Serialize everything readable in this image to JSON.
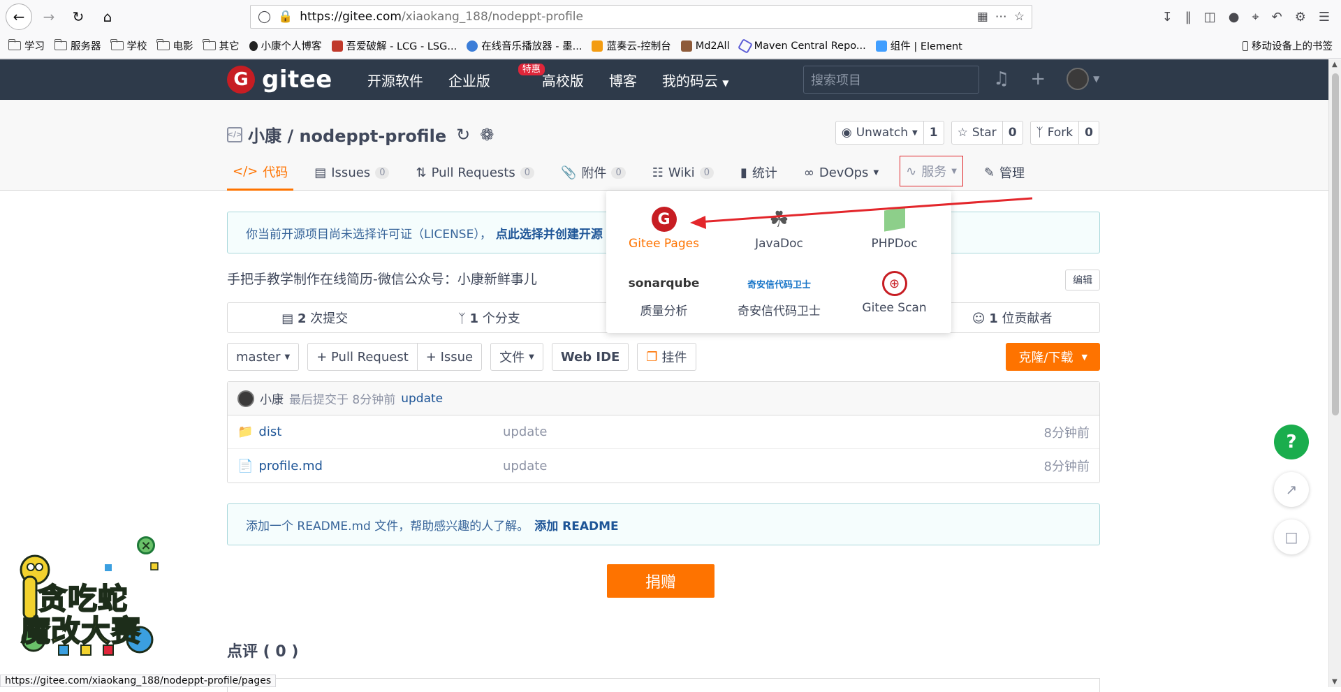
{
  "browser": {
    "url_host": "https://gitee.com",
    "url_path": "/xiaokang_188/nodeppt-profile",
    "status_url": "https://gitee.com/xiaokang_188/nodeppt-profile/pages"
  },
  "bookmarks": [
    {
      "label": "学习",
      "type": "folder"
    },
    {
      "label": "服务器",
      "type": "folder"
    },
    {
      "label": "学校",
      "type": "folder"
    },
    {
      "label": "电影",
      "type": "folder"
    },
    {
      "label": "其它",
      "type": "folder"
    },
    {
      "label": "小康个人博客",
      "type": "site",
      "color": "#222222"
    },
    {
      "label": "吾爱破解 - LCG - LSG...",
      "type": "site",
      "color": "#c0392b"
    },
    {
      "label": "在线音乐播放器 - 墨...",
      "type": "site",
      "color": "#3b7dd8"
    },
    {
      "label": "蓝奏云-控制台",
      "type": "site",
      "color": "#f39c12"
    },
    {
      "label": "Md2All",
      "type": "site",
      "color": "#8e5b3a"
    },
    {
      "label": "Maven Central Repo...",
      "type": "site",
      "color": "#5b5bd6"
    },
    {
      "label": "组件 | Element",
      "type": "site",
      "color": "#409eff"
    }
  ],
  "bookmarks_right": "移动设备上的书签",
  "gitee_nav": {
    "brand": "gitee",
    "menu": [
      "开源软件",
      "企业版",
      "高校版",
      "博客",
      "我的码云"
    ],
    "hot_badge": "特惠",
    "search_placeholder": "搜索项目"
  },
  "repo": {
    "owner": "小康",
    "name": "nodeppt-profile",
    "title": "小康 / nodeppt-profile",
    "watch_label": "Unwatch",
    "watch_count": "1",
    "star_label": "Star",
    "star_count": "0",
    "fork_label": "Fork",
    "fork_count": "0"
  },
  "tabs": [
    {
      "label": "代码",
      "count": null
    },
    {
      "label": "Issues",
      "count": "0"
    },
    {
      "label": "Pull Requests",
      "count": "0"
    },
    {
      "label": "附件",
      "count": "0"
    },
    {
      "label": "Wiki",
      "count": "0"
    },
    {
      "label": "统计",
      "count": null
    },
    {
      "label": "DevOps",
      "count": null
    },
    {
      "label": "服务",
      "count": null
    },
    {
      "label": "管理",
      "count": null
    }
  ],
  "notice": {
    "text": "你当前开源项目尚未选择许可证（LICENSE），",
    "link": "点此选择并创建开源"
  },
  "description": "手把手教学制作在线简历-微信公众号：小康新鲜事儿",
  "edit_label": "编辑",
  "stats": {
    "commits_num": "2",
    "commits_label": "次提交",
    "branches_num": "1",
    "branches_label": "个分支",
    "contributors_num": "1",
    "contributors_label": "位贡献者"
  },
  "toolbar": {
    "branch": "master",
    "pull_request": "+ Pull Request",
    "issue": "+ Issue",
    "files": "文件",
    "web_ide": "Web IDE",
    "widget": "挂件",
    "clone": "克隆/下载"
  },
  "commit": {
    "author": "小康",
    "text": "最后提交于 8分钟前",
    "message": "update"
  },
  "files": [
    {
      "name": "dist",
      "type": "folder",
      "message": "update",
      "time": "8分钟前"
    },
    {
      "name": "profile.md",
      "type": "file",
      "message": "update",
      "time": "8分钟前"
    }
  ],
  "readme": {
    "text": "添加一个 README.md 文件，帮助感兴趣的人了解。",
    "link": "添加 README"
  },
  "donate_label": "捐赠",
  "review_label": "点评 ( 0 )",
  "services_dropdown": [
    {
      "label": "Gitee Pages",
      "icon": "gitee-pages-icon"
    },
    {
      "label": "JavaDoc",
      "icon": "javadoc-icon"
    },
    {
      "label": "PHPDoc",
      "icon": "phpdoc-icon"
    },
    {
      "label": "质量分析",
      "icon": "sonarqube-icon",
      "logo_text": "sonarqube"
    },
    {
      "label": "奇安信代码卫士",
      "icon": "qianxin-icon",
      "logo_text": "奇安信代码卫士"
    },
    {
      "label": "Gitee Scan",
      "icon": "gitee-scan-icon"
    }
  ],
  "snake_ad": {
    "line1": "贪吃蛇",
    "line2": "魔改大赛"
  },
  "colors": {
    "accent": "#fe7300",
    "nav_bg": "#2e3a4a",
    "gitee_red": "#c71d23",
    "link_blue": "#1e5597",
    "help_green": "#1aad4d"
  }
}
